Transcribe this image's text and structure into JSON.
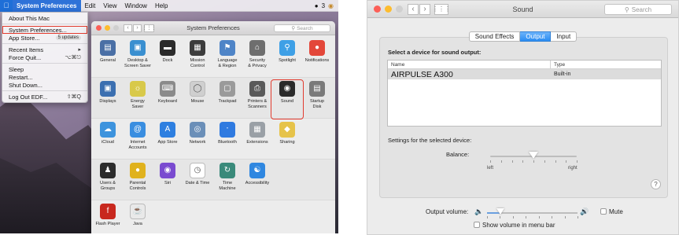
{
  "left": {
    "menubar": {
      "app_name": "System Preferences",
      "menus": [
        "Edit",
        "View",
        "Window",
        "Help"
      ],
      "status_text": "3"
    },
    "apple_menu": {
      "items": [
        {
          "label": "About This Mac",
          "shortcut": ""
        },
        {
          "label": "System Preferences...",
          "shortcut": ""
        },
        {
          "label": "App Store...",
          "shortcut": "",
          "badge": "5 updates"
        },
        {
          "label": "Recent Items",
          "shortcut": "▸"
        },
        {
          "label": "Force Quit...",
          "shortcut": "⌥⌘⎋"
        },
        {
          "label": "Sleep",
          "shortcut": ""
        },
        {
          "label": "Restart...",
          "shortcut": ""
        },
        {
          "label": "Shut Down...",
          "shortcut": ""
        },
        {
          "label": "Log Out EDF...",
          "shortcut": "⇧⌘Q"
        }
      ],
      "highlighted_index": 1
    },
    "prefs_window": {
      "title": "System Preferences",
      "search_placeholder": "Search",
      "rows": [
        [
          {
            "label": "General",
            "icon": "general-icon",
            "color": "#4a6fa5"
          },
          {
            "label": "Desktop &\nScreen Saver",
            "icon": "desktop-icon",
            "color": "#3a8fd0"
          },
          {
            "label": "Dock",
            "icon": "dock-icon",
            "color": "#2b2b2b"
          },
          {
            "label": "Mission\nControl",
            "icon": "mission-control-icon",
            "color": "#3c3c3c"
          },
          {
            "label": "Language\n& Region",
            "icon": "flag-icon",
            "color": "#4e84c7"
          },
          {
            "label": "Security\n& Privacy",
            "icon": "house-icon",
            "color": "#6e6e6e"
          },
          {
            "label": "Spotlight",
            "icon": "spotlight-icon",
            "color": "#3ea0e6"
          },
          {
            "label": "Notifications",
            "icon": "notifications-icon",
            "color": "#e3473a"
          }
        ],
        [
          {
            "label": "Displays",
            "icon": "display-icon",
            "color": "#3b6fb0"
          },
          {
            "label": "Energy\nSaver",
            "icon": "bulb-icon",
            "color": "#d8c94a"
          },
          {
            "label": "Keyboard",
            "icon": "keyboard-icon",
            "color": "#8a8a8a"
          },
          {
            "label": "Mouse",
            "icon": "mouse-icon",
            "color": "#cfcfcf"
          },
          {
            "label": "Trackpad",
            "icon": "trackpad-icon",
            "color": "#9a9a9a"
          },
          {
            "label": "Printers &\nScanners",
            "icon": "printer-icon",
            "color": "#5a5a5a"
          },
          {
            "label": "Sound",
            "icon": "speaker-icon",
            "color": "#2a2a2a"
          },
          {
            "label": "Startup\nDisk",
            "icon": "disk-icon",
            "color": "#7a7a7a"
          }
        ],
        [
          {
            "label": "iCloud",
            "icon": "cloud-icon",
            "color": "#3d93dd"
          },
          {
            "label": "Internet\nAccounts",
            "icon": "at-icon",
            "color": "#3a8ee0"
          },
          {
            "label": "App Store",
            "icon": "appstore-icon",
            "color": "#2e7fe0"
          },
          {
            "label": "Network",
            "icon": "globe-icon",
            "color": "#6b8fb8"
          },
          {
            "label": "Bluetooth",
            "icon": "bluetooth-icon",
            "color": "#2f7ae0"
          },
          {
            "label": "Extensions",
            "icon": "puzzle-icon",
            "color": "#9aa0a6"
          },
          {
            "label": "Sharing",
            "icon": "sharing-icon",
            "color": "#e6c34a"
          }
        ],
        [
          {
            "label": "Users &\nGroups",
            "icon": "users-icon",
            "color": "#2c2c2c"
          },
          {
            "label": "Parental\nControls",
            "icon": "parental-icon",
            "color": "#e0b21e"
          },
          {
            "label": "Siri",
            "icon": "siri-icon",
            "color": "#7a4bd0"
          },
          {
            "label": "Date & Time",
            "icon": "clock-icon",
            "color": "#ffffff"
          },
          {
            "label": "Time\nMachine",
            "icon": "time-machine-icon",
            "color": "#3a8a7a"
          },
          {
            "label": "Accessibility",
            "icon": "accessibility-icon",
            "color": "#2f87e0"
          }
        ],
        [
          {
            "label": "Flash Player",
            "icon": "flash-icon",
            "color": "#c8281e"
          },
          {
            "label": "Java",
            "icon": "java-icon",
            "color": "#e9e9e9"
          }
        ]
      ],
      "selected_label": "Sound"
    }
  },
  "right": {
    "window_title": "Sound",
    "search_placeholder": "Search",
    "tabs": [
      {
        "label": "Sound Effects",
        "active": false
      },
      {
        "label": "Output",
        "active": true
      },
      {
        "label": "Input",
        "active": false
      }
    ],
    "device_heading": "Select a device for sound output:",
    "table": {
      "columns": [
        "Name",
        "Type"
      ],
      "rows": [
        {
          "name": "AIRPULSE A300",
          "type": "Built-in"
        }
      ]
    },
    "settings_heading": "Settings for the selected device:",
    "balance": {
      "label": "Balance:",
      "left_label": "left",
      "right_label": "right",
      "value": 0.5
    },
    "help_label": "?",
    "output_volume": {
      "label": "Output volume:",
      "value": 0.15,
      "mute_label": "Mute",
      "muted": false
    },
    "show_volume": {
      "label": "Show volume in menu bar",
      "checked": false
    }
  }
}
